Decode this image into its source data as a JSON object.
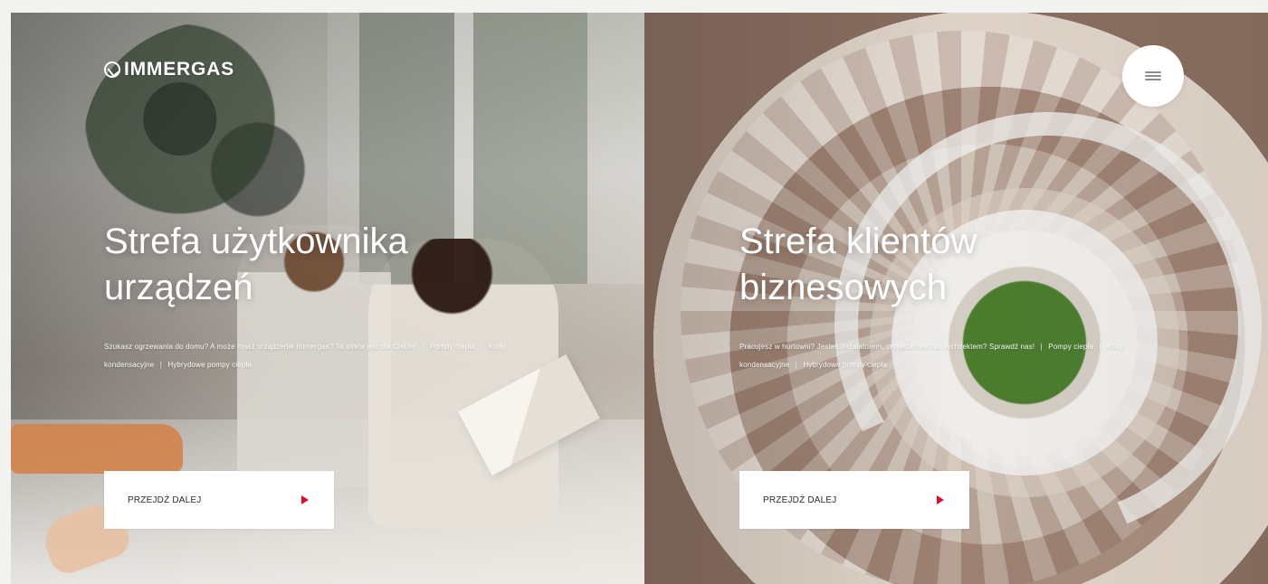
{
  "brand": {
    "name": "IMMERGAS"
  },
  "left": {
    "title": "Strefa użytkownika\nurządzeń",
    "description_intro": "Szukasz ogrzewania do domu? A może masz urządzenie Immergas? Ta strefa jest dla Ciebie!",
    "links": [
      "Pompy ciepła",
      "Kotły kondensacyjne",
      "Hybrydowe pompy ciepła"
    ],
    "cta_label": "PRZEJDŹ DALEJ"
  },
  "right": {
    "title": "Strefa klientów\nbiznesowych",
    "description_intro": "Pracujesz w hurtowni? Jesteś instalatorem, projektantem lub architektem? Sprawdź nas!",
    "links": [
      "Pompy ciepła",
      "Kotły kondensacyjne",
      "Hybrydowe pompy ciepła"
    ],
    "cta_label": "PRZEJDŹ DALEJ"
  },
  "icons": {
    "menu": "menu-icon",
    "brand": "brand-icon",
    "arrow": "play-arrow-icon"
  },
  "colors": {
    "accent": "#dc0d2f"
  }
}
